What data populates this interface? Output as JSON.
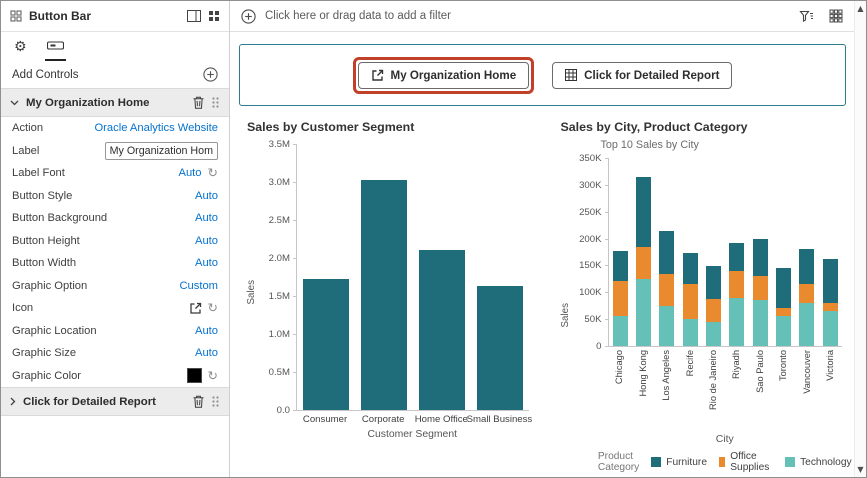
{
  "colors": {
    "accent_teal": "#2e7d8c",
    "bar_teal": "#1f6d7a",
    "furniture": "#1f6d7a",
    "office_supplies": "#ea8a2e",
    "technology": "#65c0b8",
    "link_blue": "#0572ce",
    "highlight_red": "#c0402a",
    "graphic_color_swatch": "#000000"
  },
  "icons": {
    "gear": "⚙",
    "reset": "↻",
    "scroll_up": "▲",
    "scroll_down": "▼"
  },
  "sidebar": {
    "title": "Button Bar",
    "add_controls_label": "Add Controls",
    "expanded_section": {
      "label": "My Organization Home"
    },
    "collapsed_section": {
      "label": "Click for Detailed Report"
    },
    "properties": [
      {
        "label": "Action",
        "value": "Oracle Analytics Website",
        "widget": "link"
      },
      {
        "label": "Label",
        "value": "My Organization Hom",
        "widget": "input"
      },
      {
        "label": "Label Font",
        "value": "Auto",
        "widget": "value_reset"
      },
      {
        "label": "Button Style",
        "value": "Auto",
        "widget": "value"
      },
      {
        "label": "Button Background",
        "value": "Auto",
        "widget": "value"
      },
      {
        "label": "Button Height",
        "value": "Auto",
        "widget": "value"
      },
      {
        "label": "Button Width",
        "value": "Auto",
        "widget": "value"
      },
      {
        "label": "Graphic Option",
        "value": "Custom",
        "widget": "value"
      },
      {
        "label": "Icon",
        "value": "",
        "widget": "icon_reset"
      },
      {
        "label": "Graphic Location",
        "value": "Auto",
        "widget": "value"
      },
      {
        "label": "Graphic Size",
        "value": "Auto",
        "widget": "value"
      },
      {
        "label": "Graphic Color",
        "value": "",
        "widget": "swatch_reset"
      }
    ]
  },
  "filter_bar": {
    "prompt": "Click here or drag data to add a filter"
  },
  "canvas": {
    "buttons": [
      {
        "label": "My Organization Home",
        "icon": "external-link-icon",
        "highlighted": true
      },
      {
        "label": "Click for Detailed Report",
        "icon": "table-icon",
        "highlighted": false
      }
    ]
  },
  "chart_data": [
    {
      "type": "bar",
      "title": "Sales by Customer Segment",
      "xlabel": "Customer Segment",
      "ylabel": "Sales",
      "categories": [
        "Consumer",
        "Corporate",
        "Home Office",
        "Small Business"
      ],
      "values": [
        1.72,
        3.03,
        2.1,
        1.63
      ],
      "unit": "M",
      "ymax": 3.5,
      "yticks": [
        "3.5M",
        "3.0M",
        "2.5M",
        "2.0M",
        "1.5M",
        "1.0M",
        "0.5M",
        "0.0"
      ],
      "bar_color": "#1f6d7a",
      "grid": false,
      "legend_position": "none"
    },
    {
      "type": "stacked-bar",
      "title": "Sales by City, Product Category",
      "subtitle": "Top 10 Sales by City",
      "xlabel": "City",
      "ylabel": "Sales",
      "categories": [
        "Chicago",
        "Hong Kong",
        "Los Angeles",
        "Recife",
        "Rio de Janeiro",
        "Riyadh",
        "Sao Paulo",
        "Toronto",
        "Vancouver",
        "Victoria"
      ],
      "unit": "K",
      "ymax": 350,
      "yticks": [
        "350K",
        "300K",
        "250K",
        "200K",
        "150K",
        "100K",
        "50K",
        "0"
      ],
      "series": [
        {
          "name": "Furniture",
          "color": "#1f6d7a",
          "values": [
            55,
            130,
            80,
            57,
            62,
            52,
            68,
            75,
            65,
            82
          ]
        },
        {
          "name": "Office Supplies",
          "color": "#ea8a2e",
          "values": [
            65,
            60,
            60,
            65,
            43,
            50,
            45,
            15,
            35,
            15
          ]
        },
        {
          "name": "Technology",
          "color": "#65c0b8",
          "values": [
            55,
            125,
            75,
            50,
            45,
            90,
            85,
            55,
            80,
            65
          ]
        }
      ],
      "stack_order_bottom_to_top": [
        "Technology",
        "Office Supplies",
        "Furniture"
      ],
      "legend_title": "Product Category",
      "legend_position": "bottom",
      "grid": false
    }
  ]
}
